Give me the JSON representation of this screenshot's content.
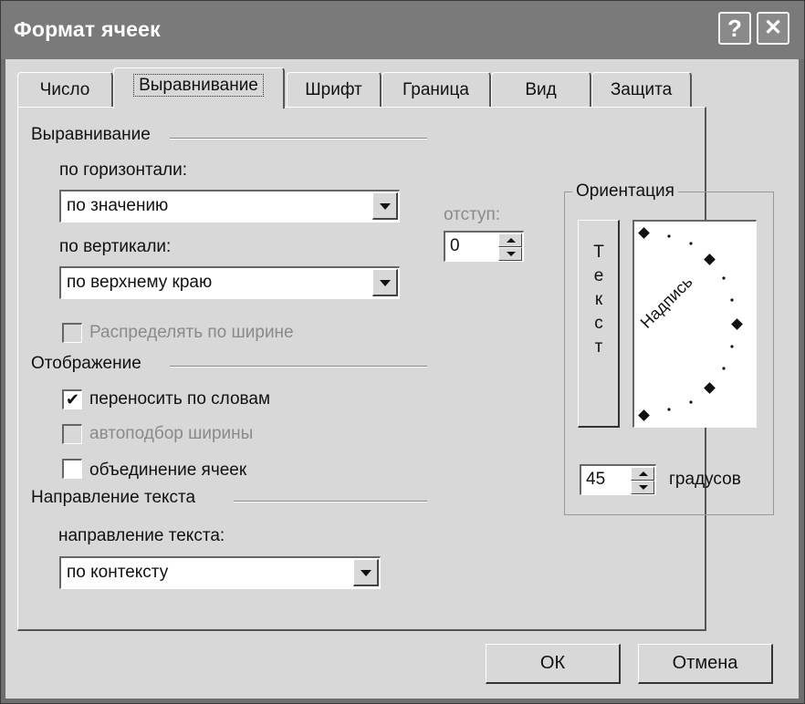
{
  "window": {
    "title": "Формат ячеек",
    "help_glyph": "?",
    "close_glyph": "✕"
  },
  "tabs": [
    {
      "label": "Число",
      "active": false
    },
    {
      "label": "Выравнивание",
      "active": true
    },
    {
      "label": "Шрифт",
      "active": false
    },
    {
      "label": "Граница",
      "active": false
    },
    {
      "label": "Вид",
      "active": false
    },
    {
      "label": "Защита",
      "active": false
    }
  ],
  "alignment": {
    "group_label": "Выравнивание",
    "horizontal_label": "по горизонтали:",
    "horizontal_value": "по значению",
    "vertical_label": "по вертикали:",
    "vertical_value": "по верхнему краю",
    "indent_label": "отступ:",
    "indent_value": "0",
    "distribute_label": "Распределять по ширине",
    "distribute_checked": false
  },
  "display": {
    "group_label": "Отображение",
    "wrap_label": "переносить по словам",
    "wrap_checked": true,
    "shrink_label": "автоподбор ширины",
    "shrink_checked": false,
    "merge_label": "объединение ячеек",
    "merge_checked": false
  },
  "direction": {
    "group_label": "Направление текста",
    "label": "направление текста:",
    "value": "по контексту"
  },
  "orientation": {
    "group_label": "Ориентация",
    "vertical_text": [
      "Т",
      "е",
      "к",
      "с",
      "т"
    ],
    "dial_text": "Надпись",
    "degrees_value": "45",
    "degrees_label": "градусов",
    "angle": 45
  },
  "buttons": {
    "ok": "ОК",
    "cancel": "Отмена"
  },
  "icons": {
    "help": "help-icon",
    "close": "close-icon",
    "check": "checkmark-icon",
    "dropdown": "chevron-down-icon"
  }
}
